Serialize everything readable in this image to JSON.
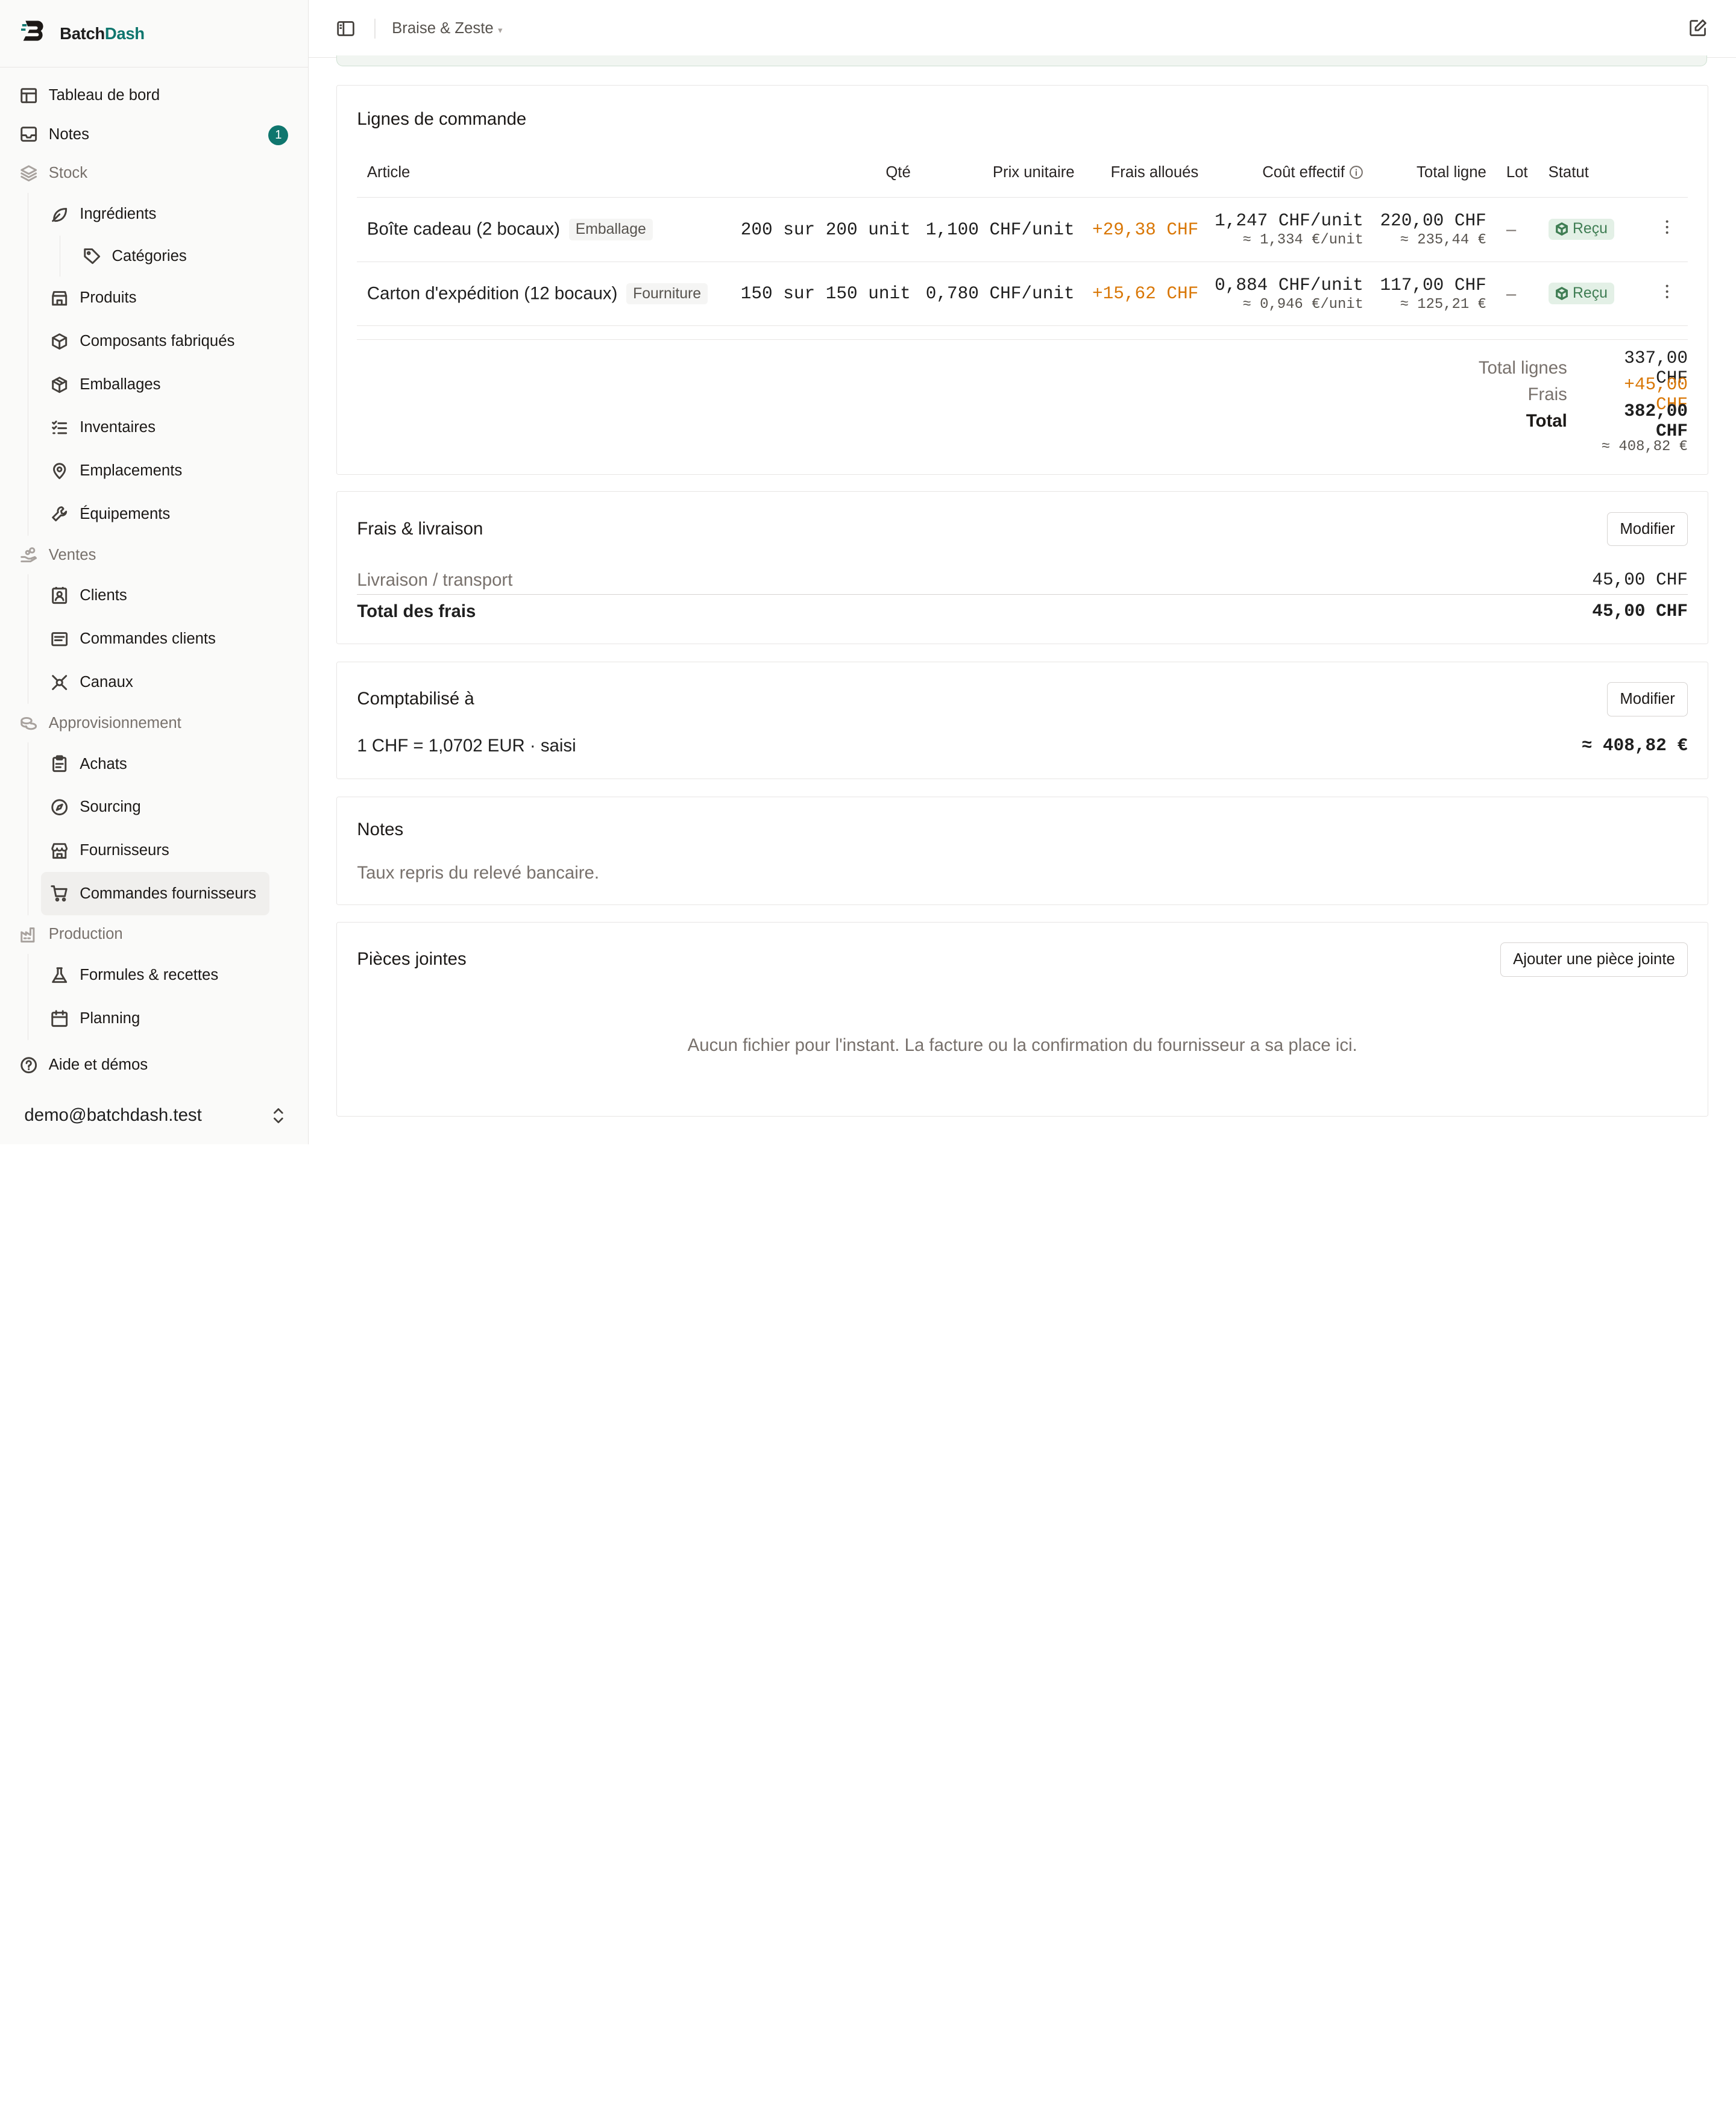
{
  "brand": {
    "name_a": "Batch",
    "name_b": "Dash"
  },
  "nav": {
    "dashboard": "Tableau de bord",
    "notes": "Notes",
    "notes_badge": "1",
    "stock": "Stock",
    "ingredients": "Ingrédients",
    "categories": "Catégories",
    "products": "Produits",
    "components": "Composants fabriqués",
    "packaging": "Emballages",
    "inventories": "Inventaires",
    "locations": "Emplacements",
    "equipment": "Équipements",
    "sales": "Ventes",
    "clients": "Clients",
    "client_orders": "Commandes clients",
    "channels": "Canaux",
    "supply": "Approvisionnement",
    "purchases": "Achats",
    "sourcing": "Sourcing",
    "suppliers": "Fournisseurs",
    "supplier_orders": "Commandes fournisseurs",
    "production": "Production",
    "recipes": "Formules & recettes",
    "planning": "Planning",
    "help": "Aide et démos"
  },
  "user": {
    "email": "demo@batchdash.test"
  },
  "topbar": {
    "workspace": "Braise & Zeste",
    "caret": "▾"
  },
  "lines": {
    "title": "Lignes de commande",
    "columns": {
      "article": "Article",
      "qty": "Qté",
      "unit_price": "Prix unitaire",
      "fees": "Frais alloués",
      "effective": "Coût effectif",
      "total": "Total ligne",
      "lot": "Lot",
      "status": "Statut"
    },
    "rows": [
      {
        "article": "Boîte cadeau (2 bocaux)",
        "tag": "Emballage",
        "qty": "200 sur 200 unit",
        "unit_price": "1,100 CHF/unit",
        "fees": "+29,38 CHF",
        "effective": "1,247 CHF/unit",
        "effective_eur": "≈ 1,334 €/unit",
        "total": "220,00 CHF",
        "total_eur": "≈ 235,44 €",
        "lot": "–",
        "status": "Reçu"
      },
      {
        "article": "Carton d'expédition (12 bocaux)",
        "tag": "Fourniture",
        "qty": "150 sur 150 unit",
        "unit_price": "0,780 CHF/unit",
        "fees": "+15,62 CHF",
        "effective": "0,884 CHF/unit",
        "effective_eur": "≈ 0,946 €/unit",
        "total": "117,00 CHF",
        "total_eur": "≈ 125,21 €",
        "lot": "–",
        "status": "Reçu"
      }
    ],
    "totals": {
      "lines_label": "Total lignes",
      "lines_value": "337,00 CHF",
      "fees_label": "Frais",
      "fees_value": "+45,00 CHF",
      "total_label": "Total",
      "total_value": "382,00 CHF",
      "total_eur": "≈ 408,82 €"
    }
  },
  "fees": {
    "title": "Frais & livraison",
    "edit": "Modifier",
    "row_label": "Livraison / transport",
    "row_value": "45,00 CHF",
    "total_label": "Total des frais",
    "total_value": "45,00 CHF"
  },
  "accounting": {
    "title": "Comptabilisé à",
    "edit": "Modifier",
    "rate": "1 CHF = 1,0702 EUR · saisi",
    "value": "≈ 408,82 €"
  },
  "notes": {
    "title": "Notes",
    "text": "Taux repris du relevé bancaire."
  },
  "attachments": {
    "title": "Pièces jointes",
    "add": "Ajouter une pièce jointe",
    "empty": "Aucun fichier pour l'instant. La facture ou la confirmation du fournisseur a sa place ici."
  },
  "colors": {
    "accent": "#0f766e",
    "fees": "#d97706",
    "status_bg": "#e3f0e6",
    "status_fg": "#3f7d53"
  }
}
